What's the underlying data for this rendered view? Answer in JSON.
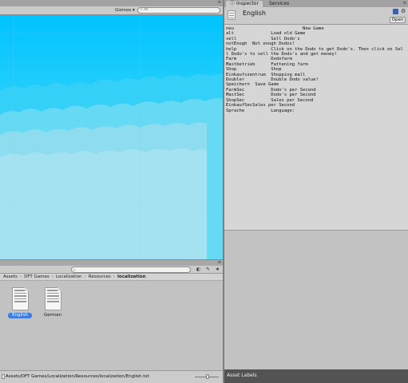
{
  "scene": {
    "gizmos_label": "Gizmos",
    "search_placeholder": "All",
    "panel_menu": "≡",
    "sky": {
      "top_color": "#00c3ff",
      "mid_color": "#2bd1fb",
      "cloud_color": "#66d9f4",
      "bottom_color": "#a5e2f1"
    }
  },
  "project": {
    "panel_menu": "≡",
    "breadcrumb": [
      "Assets",
      "DFT Games",
      "Localization",
      "Resources",
      "localization"
    ],
    "assets": [
      {
        "name": "English",
        "selected": true
      },
      {
        "name": "German",
        "selected": false
      }
    ],
    "status_path": "Assets/DFT Games/Localization/Resources/localization/English.txt"
  },
  "inspector": {
    "tabs": [
      "Inspector",
      "Services"
    ],
    "panel_menu": "≡",
    "asset_name": "English",
    "open_label": "Open",
    "text_content": "neu                          New Game\nalt              Load old Game\nsell             Sell Dodo's\nnotEnogh  Not enogh Dodos!\nhelp             Click on the Dodo to get Dodo's. Then click on Sell Dodo's to sell the Dodo's and get money!\nFarm             Dodofarm\nMastbetrieb      Fattening farm\nShop             Shop\nEinkaufszentrum  Shopping mall\nDoubler          Double Dodo value!\nSpeichern  Save Game\nFarmSec          Dodo's per Second\nMastSec          Dodo's per Second\nShopSec          Sales per Second\nEinkaufSecSales per Second\nSprache          Language:",
    "footer_label": "Asset Labels"
  }
}
